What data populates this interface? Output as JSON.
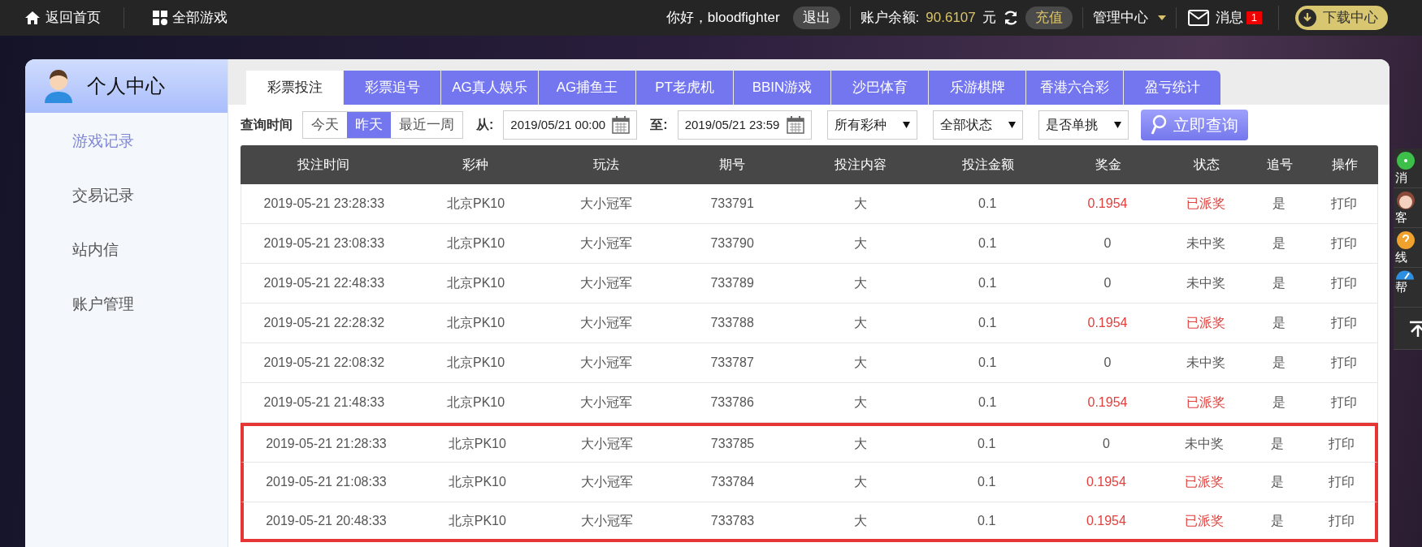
{
  "top_bar": {
    "home": "返回首页",
    "games": "全部游戏",
    "greeting": "你好，bloodfighter",
    "logout": "退出",
    "balance_label": "账户余额:",
    "balance": "90.6107",
    "currency": "元",
    "recharge": "充值",
    "manage": "管理中心",
    "messages": "消息",
    "message_count": "1",
    "download": "下载中心"
  },
  "sidebar": {
    "title": "个人中心",
    "items": [
      {
        "label": "游戏记录",
        "selected": true
      },
      {
        "label": "交易记录",
        "selected": false
      },
      {
        "label": "站内信",
        "selected": false
      },
      {
        "label": "账户管理",
        "selected": false
      }
    ]
  },
  "tabs": [
    {
      "label": "彩票投注",
      "selected": true
    },
    {
      "label": "彩票追号",
      "selected": false
    },
    {
      "label": "AG真人娱乐",
      "selected": false
    },
    {
      "label": "AG捕鱼王",
      "selected": false
    },
    {
      "label": "PT老虎机",
      "selected": false
    },
    {
      "label": "BBIN游戏",
      "selected": false
    },
    {
      "label": "沙巴体育",
      "selected": false
    },
    {
      "label": "乐游棋牌",
      "selected": false
    },
    {
      "label": "香港六合彩",
      "selected": false
    },
    {
      "label": "盈亏统计",
      "selected": false
    }
  ],
  "filters": {
    "label": "查询时间",
    "ranges": [
      {
        "label": "今天",
        "selected": false
      },
      {
        "label": "昨天",
        "selected": true
      },
      {
        "label": "最近一周",
        "selected": false
      }
    ],
    "from_label": "从:",
    "from": "2019/05/21 00:00",
    "to_label": "至:",
    "to": "2019/05/21 23:59",
    "selects": [
      "所有彩种",
      "全部状态",
      "是否单挑"
    ],
    "search": "立即查询"
  },
  "table": {
    "columns": [
      "投注时间",
      "彩种",
      "玩法",
      "期号",
      "投注内容",
      "投注金额",
      "奖金",
      "状态",
      "追号",
      "操作"
    ],
    "rows": [
      {
        "cells": [
          "2019-05-21 23:28:33",
          "北京PK10",
          "大小冠军",
          "733791",
          "大",
          "0.1",
          "0.1954",
          "已派奖",
          "是",
          "打印"
        ],
        "won": true,
        "highlighted": false
      },
      {
        "cells": [
          "2019-05-21 23:08:33",
          "北京PK10",
          "大小冠军",
          "733790",
          "大",
          "0.1",
          "0",
          "未中奖",
          "是",
          "打印"
        ],
        "won": false,
        "highlighted": false
      },
      {
        "cells": [
          "2019-05-21 22:48:33",
          "北京PK10",
          "大小冠军",
          "733789",
          "大",
          "0.1",
          "0",
          "未中奖",
          "是",
          "打印"
        ],
        "won": false,
        "highlighted": false
      },
      {
        "cells": [
          "2019-05-21 22:28:32",
          "北京PK10",
          "大小冠军",
          "733788",
          "大",
          "0.1",
          "0.1954",
          "已派奖",
          "是",
          "打印"
        ],
        "won": true,
        "highlighted": false
      },
      {
        "cells": [
          "2019-05-21 22:08:32",
          "北京PK10",
          "大小冠军",
          "733787",
          "大",
          "0.1",
          "0",
          "未中奖",
          "是",
          "打印"
        ],
        "won": false,
        "highlighted": false
      },
      {
        "cells": [
          "2019-05-21 21:48:33",
          "北京PK10",
          "大小冠军",
          "733786",
          "大",
          "0.1",
          "0.1954",
          "已派奖",
          "是",
          "打印"
        ],
        "won": true,
        "highlighted": false
      },
      {
        "cells": [
          "2019-05-21 21:28:33",
          "北京PK10",
          "大小冠军",
          "733785",
          "大",
          "0.1",
          "0",
          "未中奖",
          "是",
          "打印"
        ],
        "won": false,
        "highlighted": true
      },
      {
        "cells": [
          "2019-05-21 21:08:33",
          "北京PK10",
          "大小冠军",
          "733784",
          "大",
          "0.1",
          "0.1954",
          "已派奖",
          "是",
          "打印"
        ],
        "won": true,
        "highlighted": true
      },
      {
        "cells": [
          "2019-05-21 20:48:33",
          "北京PK10",
          "大小冠军",
          "733783",
          "大",
          "0.1",
          "0.1954",
          "已派奖",
          "是",
          "打印"
        ],
        "won": true,
        "highlighted": true
      }
    ]
  },
  "side_panel": {
    "items": [
      {
        "kind": "chat",
        "label": "消"
      },
      {
        "kind": "agent",
        "label": "客"
      },
      {
        "kind": "help",
        "label": "线"
      },
      {
        "kind": "speed",
        "label": "帮"
      },
      {
        "kind": "top"
      }
    ]
  }
}
